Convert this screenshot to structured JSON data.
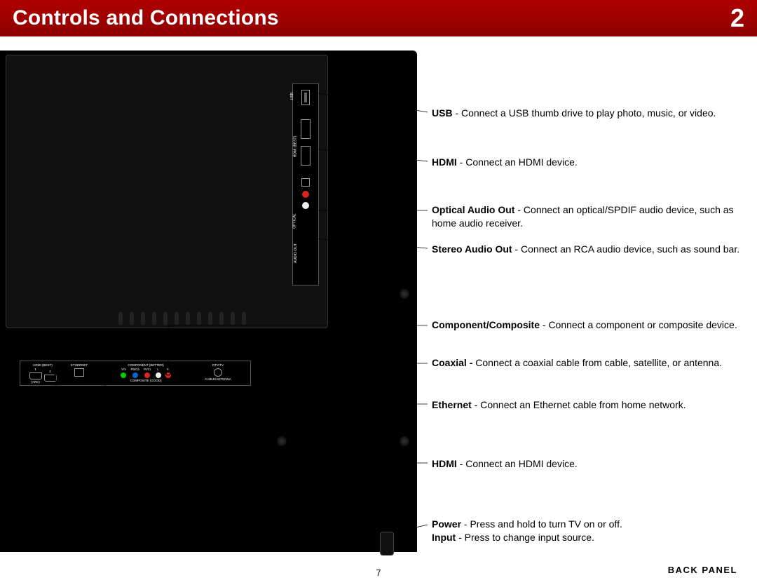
{
  "header": {
    "title": "Controls and Connections",
    "chapter": "2"
  },
  "callouts": {
    "usb": {
      "bold": "USB",
      "text": " - Connect a USB thumb drive to play photo, music, or video."
    },
    "hdmi_side": {
      "bold": "HDMI",
      "text": " - Connect an HDMI device."
    },
    "optical": {
      "bold": "Optical Audio Out",
      "text": " - Connect an optical/SPDIF audio device, such as home audio receiver."
    },
    "stereo": {
      "bold": "Stereo Audio Out",
      "text": " - Connect an RCA audio device, such as sound bar."
    },
    "component": {
      "bold": "Component/Composite",
      "text": " - Connect a component or composite device."
    },
    "coax": {
      "bold": "Coaxial - ",
      "text": "Connect a coaxial cable from cable, satellite, or antenna."
    },
    "ethernet": {
      "bold": "Ethernet",
      "text": " - Connect an Ethernet cable from home network."
    },
    "hdmi_bottom": {
      "bold": "HDMI",
      "text": " - Connect an HDMI device."
    },
    "power": {
      "bold": "Power",
      "text": " - Press and hold to turn TV on or off."
    },
    "input": {
      "bold": "Input",
      "text": " - Press to change input source."
    }
  },
  "port_labels": {
    "side": {
      "usb": "USB",
      "hdmi": "HDMI (BEST)",
      "optical": "OPTICAL",
      "audio_out": "AUDIO OUT"
    },
    "bottom": {
      "hdmi": "HDMI (BEST)",
      "arc": "(ARC)",
      "n1": "1",
      "n2": "2",
      "ethernet": "ETHERNET",
      "component": "COMPONENT (BETTER)",
      "composite": "COMPOSITE (GOOD)",
      "yv": "Y/V",
      "pbcb": "Pb/Cb",
      "prcr": "Pr/Cr",
      "l": "L",
      "r": "R",
      "dtv": "DTV/TV",
      "cable": "CABLE/ANTENNA"
    }
  },
  "footer": {
    "back_panel": "BACK PANEL",
    "page": "7"
  }
}
